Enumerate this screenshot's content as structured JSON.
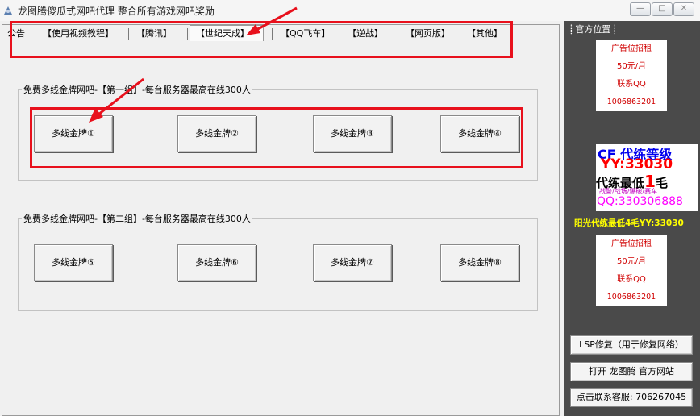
{
  "window": {
    "title": "龙图腾傻瓜式网吧代理 整合所有游戏网吧奖励",
    "minimize_glyph": "—",
    "maximize_glyph": "□",
    "close_glyph": "✕"
  },
  "tabs": [
    {
      "label": "公告"
    },
    {
      "label": "【使用视频教程】"
    },
    {
      "label": "【腾讯】"
    },
    {
      "label": "【世纪天成】"
    },
    {
      "label": "【QQ飞车】"
    },
    {
      "label": "【逆战】"
    },
    {
      "label": "【网页版】"
    },
    {
      "label": "【其他】"
    }
  ],
  "group1": {
    "title": "免费多线金牌网吧-【第一组】-每台服务器最高在线300人",
    "buttons": [
      "多线金牌①",
      "多线金牌②",
      "多线金牌③",
      "多线金牌④"
    ]
  },
  "group2": {
    "title": "免费多线金牌网吧-【第二组】-每台服务器最高在线300人",
    "buttons": [
      "多线金牌⑤",
      "多线金牌⑥",
      "多线金牌⑦",
      "多线金牌⑧"
    ]
  },
  "sidebar": {
    "title": "官方位置",
    "ad_top": {
      "line1": "广告位招租",
      "line2": "50元/月",
      "line3": "联系QQ",
      "qq": "1006863201"
    },
    "cf_ad": {
      "line1_prefix": "CF",
      "line1_main": "代练等级",
      "line2": "YY:33030",
      "line3_prefix": "代练最低",
      "line3_big": "1",
      "line3_suffix": "毛",
      "line4": "战警/战场/爆破/赛车",
      "line5": "QQ:330306888"
    },
    "promo": "阳光代练最低4毛YY:33030",
    "ad_bottom": {
      "line1": "广告位招租",
      "line2": "50元/月",
      "line3": "联系QQ",
      "qq": "1006863201"
    },
    "buttons": {
      "lsp": "LSP修复（用于修复网络）",
      "website": "打开 龙图腾 官方网站",
      "support": "点击联系客服: 706267045"
    }
  },
  "colors": {
    "annotation_red": "#e8101c",
    "sidebar_bg": "#4a4a4a",
    "ad_text": "#d00000",
    "promo_text": "#ffff00"
  }
}
